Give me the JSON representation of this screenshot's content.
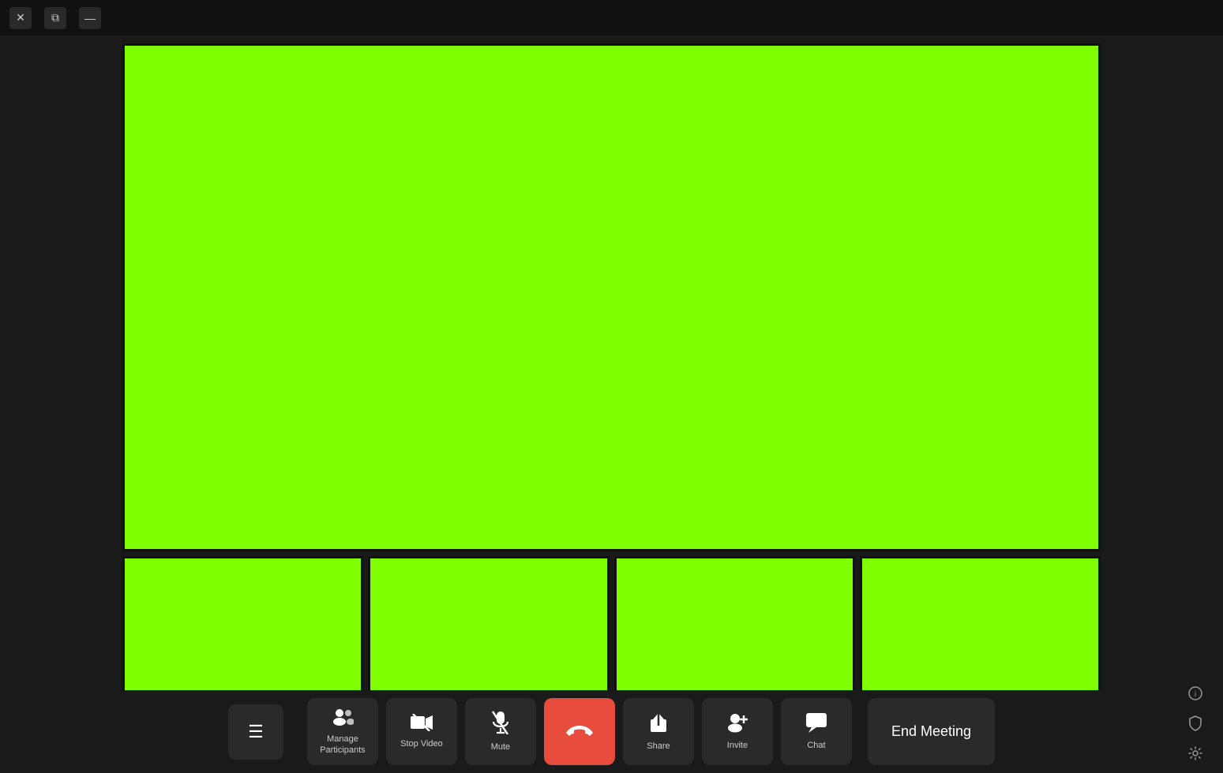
{
  "titleBar": {
    "closeLabel": "✕",
    "layoutLabel": "⧉",
    "minimizeLabel": "—"
  },
  "toolbar": {
    "menuIcon": "≡",
    "buttons": [
      {
        "id": "manage-participants",
        "label": "Manage\nParticipants",
        "icon": "participants"
      },
      {
        "id": "stop-video",
        "label": "Stop Video",
        "icon": "video"
      },
      {
        "id": "mute",
        "label": "Mute",
        "icon": "mic"
      },
      {
        "id": "share",
        "label": "Share",
        "icon": "share"
      },
      {
        "id": "invite",
        "label": "Invite",
        "icon": "invite"
      },
      {
        "id": "chat",
        "label": "Chat",
        "icon": "chat"
      }
    ],
    "endMeetingLabel": "End Meeting",
    "rightIcons": [
      "info",
      "shield",
      "settings"
    ]
  },
  "colors": {
    "videoFill": "#7fff00",
    "background": "#1a1a1a",
    "toolbar": "#1a1a1a",
    "btn": "#2a2a2a",
    "endCall": "#e74c3c"
  }
}
